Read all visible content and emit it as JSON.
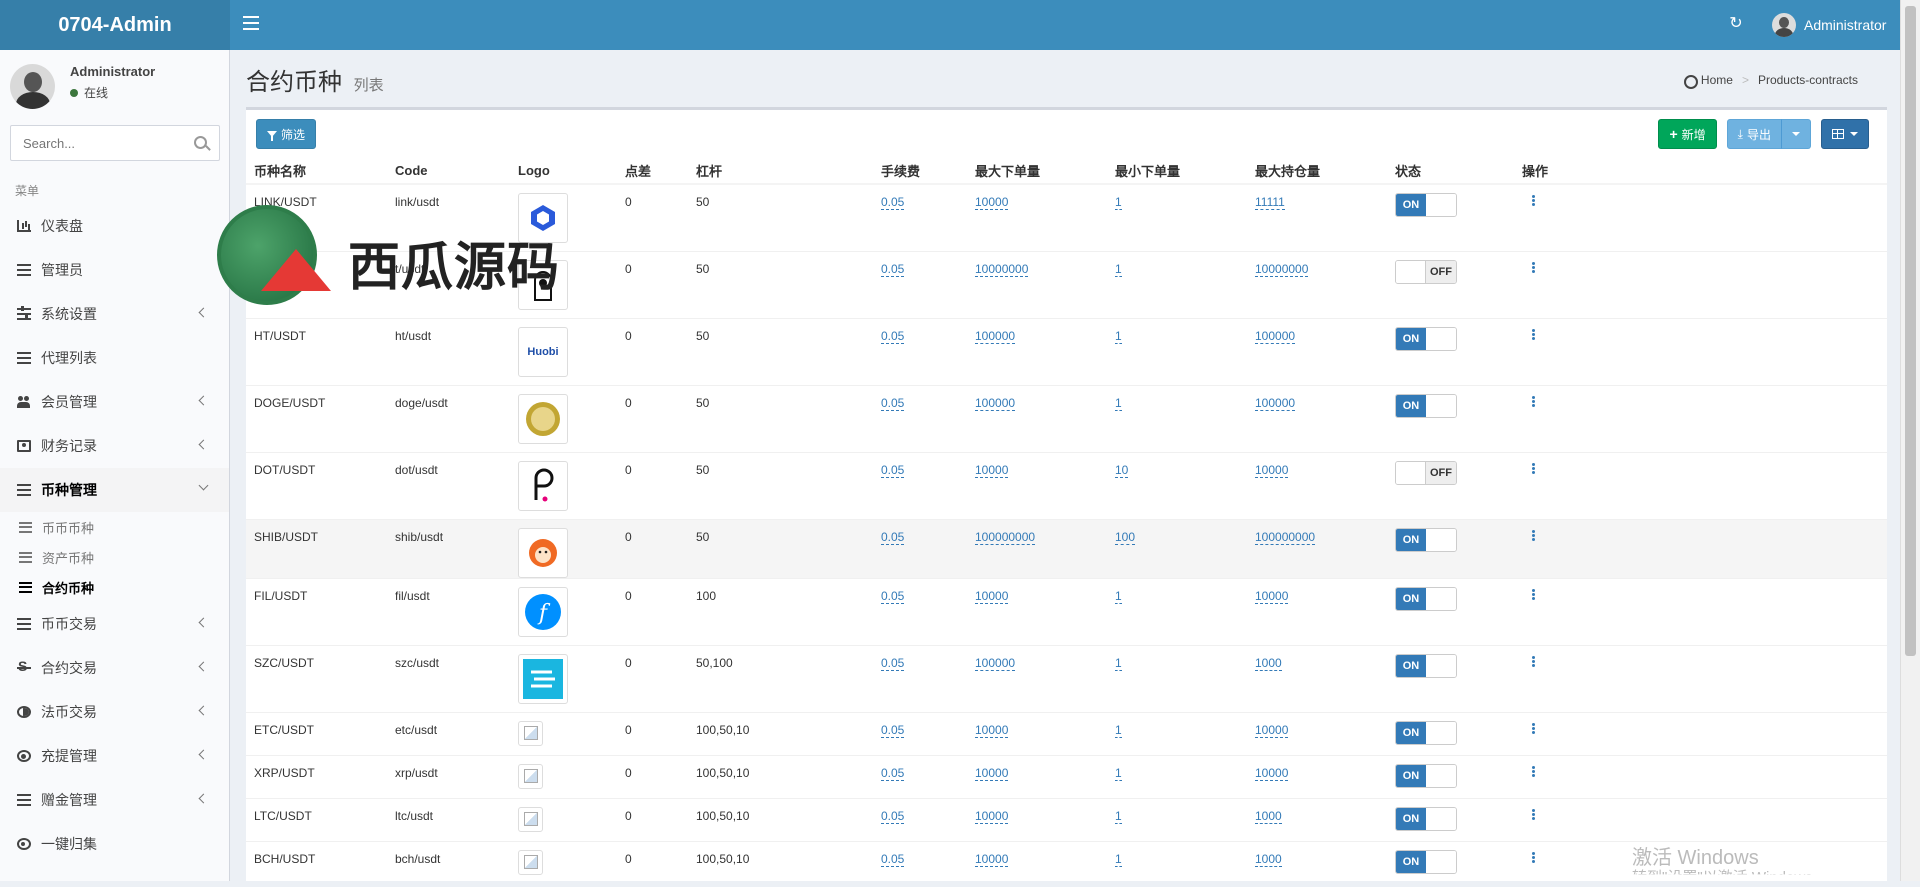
{
  "header": {
    "brand": "0704-Admin",
    "user": "Administrator"
  },
  "sidebar": {
    "user_name": "Administrator",
    "user_status": "在线",
    "search_placeholder": "Search...",
    "menu_header": "菜单",
    "items": [
      {
        "label": "仪表盘",
        "icon": "bar-chart-icon"
      },
      {
        "label": "管理员",
        "icon": "id-card-icon"
      },
      {
        "label": "系统设置",
        "icon": "sliders-icon"
      },
      {
        "label": "代理列表",
        "icon": "list-icon"
      },
      {
        "label": "会员管理",
        "icon": "users-icon"
      },
      {
        "label": "财务记录",
        "icon": "money-icon"
      },
      {
        "label": "币种管理",
        "icon": "list-icon"
      },
      {
        "label": "币币交易",
        "icon": "list-icon"
      },
      {
        "label": "合约交易",
        "icon": "strikethrough-icon"
      },
      {
        "label": "法币交易",
        "icon": "half-circle-icon"
      },
      {
        "label": "充提管理",
        "icon": "dashboard-icon"
      },
      {
        "label": "赠金管理",
        "icon": "list-icon"
      },
      {
        "label": "一键归集",
        "icon": "target-icon"
      }
    ],
    "sub_items": [
      {
        "label": "币币币种"
      },
      {
        "label": "资产币种"
      },
      {
        "label": "合约币种"
      }
    ]
  },
  "page": {
    "title": "合约币种",
    "subtitle": "列表",
    "breadcrumb_home": "Home",
    "breadcrumb_current": "Products-contracts"
  },
  "toolbar": {
    "filter": "筛选",
    "add": "新增",
    "export": "导出"
  },
  "table": {
    "columns": [
      "币种名称",
      "Code",
      "Logo",
      "点差",
      "杠杆",
      "手续费",
      "最大下单量",
      "最小下单量",
      "最大持仓量",
      "状态",
      "操作"
    ],
    "rows": [
      {
        "name": "LINK/USDT",
        "code": "link/usdt",
        "spread": "0",
        "leverage": "50",
        "fee": "0.05",
        "max_order": "10000",
        "min_order": "1",
        "max_pos": "11111",
        "status": "ON"
      },
      {
        "name": "",
        "code": "t/usdt",
        "spread": "0",
        "leverage": "50",
        "fee": "0.05",
        "max_order": "10000000",
        "min_order": "1",
        "max_pos": "10000000",
        "status": "OFF"
      },
      {
        "name": "HT/USDT",
        "code": "ht/usdt",
        "spread": "0",
        "leverage": "50",
        "fee": "0.05",
        "max_order": "100000",
        "min_order": "1",
        "max_pos": "100000",
        "status": "ON"
      },
      {
        "name": "DOGE/USDT",
        "code": "doge/usdt",
        "spread": "0",
        "leverage": "50",
        "fee": "0.05",
        "max_order": "100000",
        "min_order": "1",
        "max_pos": "100000",
        "status": "ON"
      },
      {
        "name": "DOT/USDT",
        "code": "dot/usdt",
        "spread": "0",
        "leverage": "50",
        "fee": "0.05",
        "max_order": "10000",
        "min_order": "10",
        "max_pos": "10000",
        "status": "OFF"
      },
      {
        "name": "SHIB/USDT",
        "code": "shib/usdt",
        "spread": "0",
        "leverage": "50",
        "fee": "0.05",
        "max_order": "100000000",
        "min_order": "100",
        "max_pos": "100000000",
        "status": "ON"
      },
      {
        "name": "FIL/USDT",
        "code": "fil/usdt",
        "spread": "0",
        "leverage": "100",
        "fee": "0.05",
        "max_order": "10000",
        "min_order": "1",
        "max_pos": "10000",
        "status": "ON"
      },
      {
        "name": "SZC/USDT",
        "code": "szc/usdt",
        "spread": "0",
        "leverage": "50,100",
        "fee": "0.05",
        "max_order": "100000",
        "min_order": "1",
        "max_pos": "1000",
        "status": "ON"
      },
      {
        "name": "ETC/USDT",
        "code": "etc/usdt",
        "spread": "0",
        "leverage": "100,50,10",
        "fee": "0.05",
        "max_order": "10000",
        "min_order": "1",
        "max_pos": "10000",
        "status": "ON"
      },
      {
        "name": "XRP/USDT",
        "code": "xrp/usdt",
        "spread": "0",
        "leverage": "100,50,10",
        "fee": "0.05",
        "max_order": "10000",
        "min_order": "1",
        "max_pos": "10000",
        "status": "ON"
      },
      {
        "name": "LTC/USDT",
        "code": "ltc/usdt",
        "spread": "0",
        "leverage": "100,50,10",
        "fee": "0.05",
        "max_order": "10000",
        "min_order": "1",
        "max_pos": "1000",
        "status": "ON"
      },
      {
        "name": "BCH/USDT",
        "code": "bch/usdt",
        "spread": "0",
        "leverage": "100,50,10",
        "fee": "0.05",
        "max_order": "10000",
        "min_order": "1",
        "max_pos": "1000",
        "status": "ON"
      }
    ],
    "logo_huobi": "Huobi"
  },
  "watermark": {
    "text": "西瓜源码",
    "os_line1": "激活 Windows",
    "os_line2": "转到\"设置\"以激活 Windows"
  },
  "colors": {
    "header": "#3c8dbc",
    "brand_bg": "#367fa9",
    "primary": "#3c8dbc",
    "success": "#00a65a",
    "link": "#337ab7"
  }
}
